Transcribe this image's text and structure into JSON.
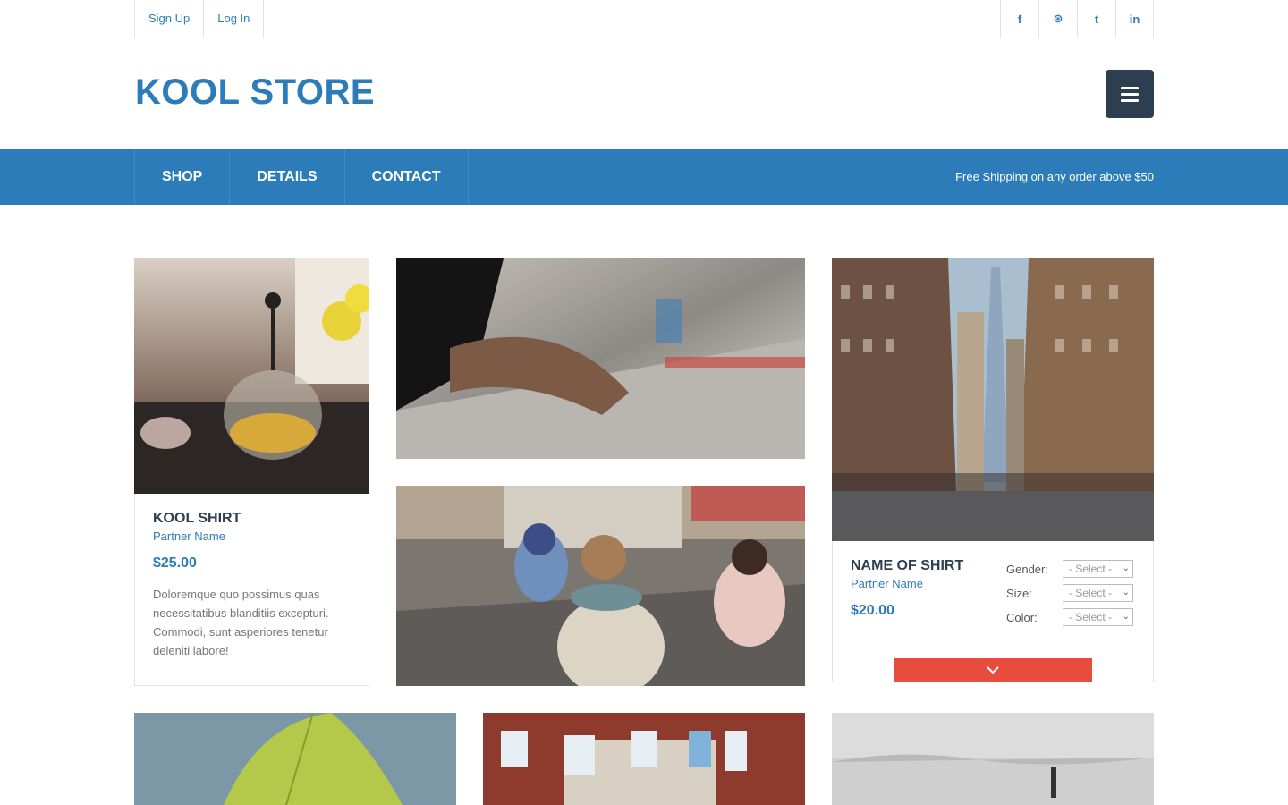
{
  "topbar": {
    "links": [
      "Sign Up",
      "Log In"
    ],
    "social": [
      {
        "icon": "facebook-icon",
        "glyph": "f"
      },
      {
        "icon": "dribbble-icon",
        "glyph": "⊛"
      },
      {
        "icon": "twitter-icon",
        "glyph": "t"
      },
      {
        "icon": "linkedin-icon",
        "glyph": "in"
      }
    ]
  },
  "header": {
    "logo": "KOOL STORE"
  },
  "nav": {
    "items": [
      "SHOP",
      "DETAILS",
      "CONTACT"
    ],
    "shipping": "Free Shipping on any order above $50"
  },
  "products": [
    {
      "name": "KOOL SHIRT",
      "partner": "Partner Name",
      "price": "$25.00",
      "description": "Doloremque quo possimus quas necessitatibus blanditiis excepturi. Commodi, sunt asperiores tenetur deleniti labore!"
    },
    {
      "name": "NAME OF SHIRT",
      "partner": "Partner Name",
      "price": "$20.00",
      "options": [
        {
          "label": "Gender:",
          "value": "- Select -"
        },
        {
          "label": "Size:",
          "value": "- Select -"
        },
        {
          "label": "Color:",
          "value": "- Select -"
        }
      ]
    }
  ],
  "colors": {
    "brand": "#2c7cb9",
    "dark": "#2c3e50",
    "accent": "#e74c3c"
  }
}
